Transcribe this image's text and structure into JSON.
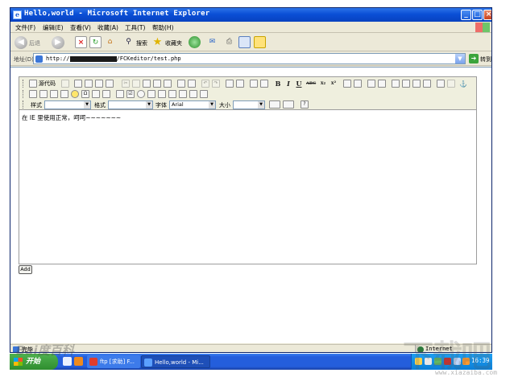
{
  "window": {
    "title": "Hello,world - Microsoft Internet Explorer",
    "controls": [
      "_",
      "□",
      "×"
    ]
  },
  "menu": [
    "文件(F)",
    "编辑(E)",
    "查看(V)",
    "收藏(A)",
    "工具(T)",
    "帮助(H)"
  ],
  "toolbar": {
    "back_label": "后退",
    "search_label": "搜索",
    "favorites_label": "收藏夹"
  },
  "address": {
    "label": "地址(D)",
    "url_prefix": "http://",
    "url_suffix": "/FCKeditor/test.php",
    "go_label": "转到"
  },
  "editor": {
    "source_label": "源代码",
    "style_label": "样式",
    "format_label": "格式",
    "font_label": "字体",
    "font_value": "Arial",
    "size_label": "大小",
    "content": "在 IE 里使用正常，呵呵~~~~~~~"
  },
  "form": {
    "add_label": "Add"
  },
  "status": {
    "text": "完毕",
    "zone": "Internet"
  },
  "taskbar": {
    "start_label": "开始",
    "tasks": [
      {
        "label": "ftp [求助] F..."
      },
      {
        "label": "Hello,world - Mi..."
      }
    ],
    "clock": "16:39"
  },
  "watermark": {
    "left": "Bai度百科",
    "right": "下载吧",
    "right_sub": "www.xiazaiba.com"
  },
  "colors": {
    "titlebar": "#0a4fd6",
    "taskbar": "#245edc",
    "start": "#2f8d2f",
    "chrome": "#ece9d8"
  }
}
